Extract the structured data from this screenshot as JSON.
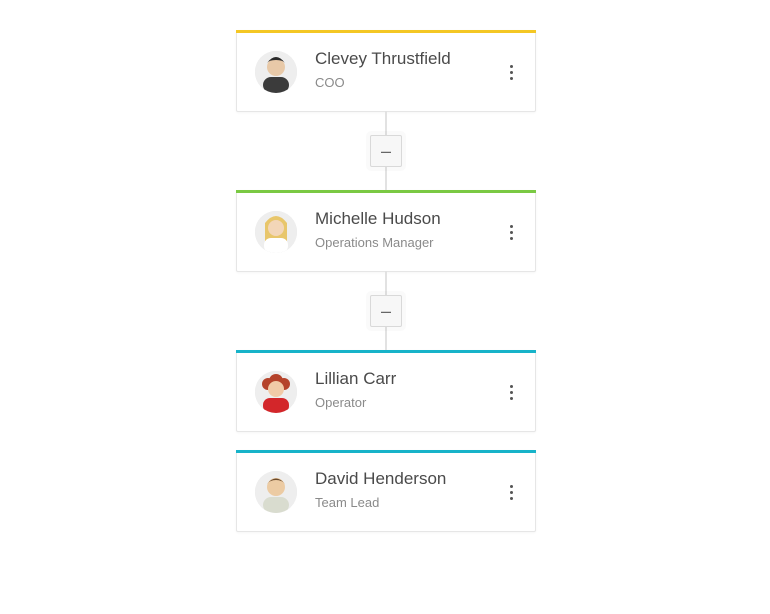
{
  "collapse_glyph": "–",
  "org": [
    {
      "name": "Clevey Thrustfield",
      "role": "COO",
      "accent": "#f4c724",
      "avatar": "man-dark-short-hair"
    },
    {
      "name": "Michelle Hudson",
      "role": "Operations Manager",
      "accent": "#7ac943",
      "avatar": "woman-blonde"
    },
    {
      "name": "Lillian Carr",
      "role": "Operator",
      "accent": "#17b3c9",
      "avatar": "woman-red-curly"
    },
    {
      "name": "David Henderson",
      "role": "Team Lead",
      "accent": "#17b3c9",
      "avatar": "man-brown-short-hair"
    }
  ]
}
